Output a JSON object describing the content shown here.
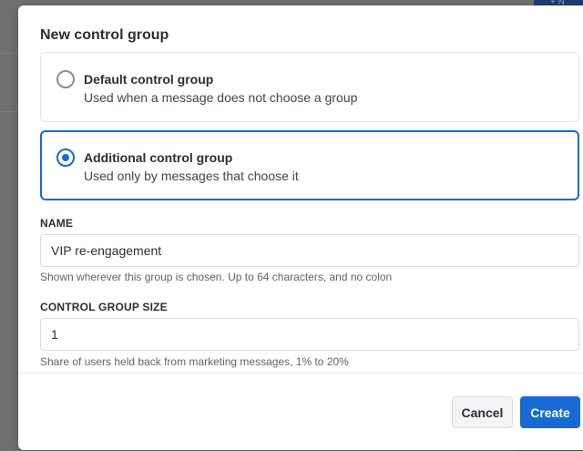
{
  "background": {
    "corner_button_glyph": "+ N"
  },
  "modal": {
    "title": "New control group",
    "options": [
      {
        "label": "Default control group",
        "description": "Used when a message does not choose a group",
        "selected": false
      },
      {
        "label": "Additional control group",
        "description": "Used only by messages that choose it",
        "selected": true
      }
    ],
    "name_field": {
      "label": "NAME",
      "value": "VIP re-engagement",
      "helper": "Shown wherever this group is chosen. Up to 64 characters, and no colon"
    },
    "size_field": {
      "label": "CONTROL GROUP SIZE",
      "value": "1",
      "helper": "Share of users held back from marketing messages, 1% to 20%"
    },
    "buttons": {
      "cancel": "Cancel",
      "create": "Create"
    }
  },
  "colors": {
    "accent": "#1769d4",
    "text": "#2b2f33",
    "overlay": "#707070"
  }
}
